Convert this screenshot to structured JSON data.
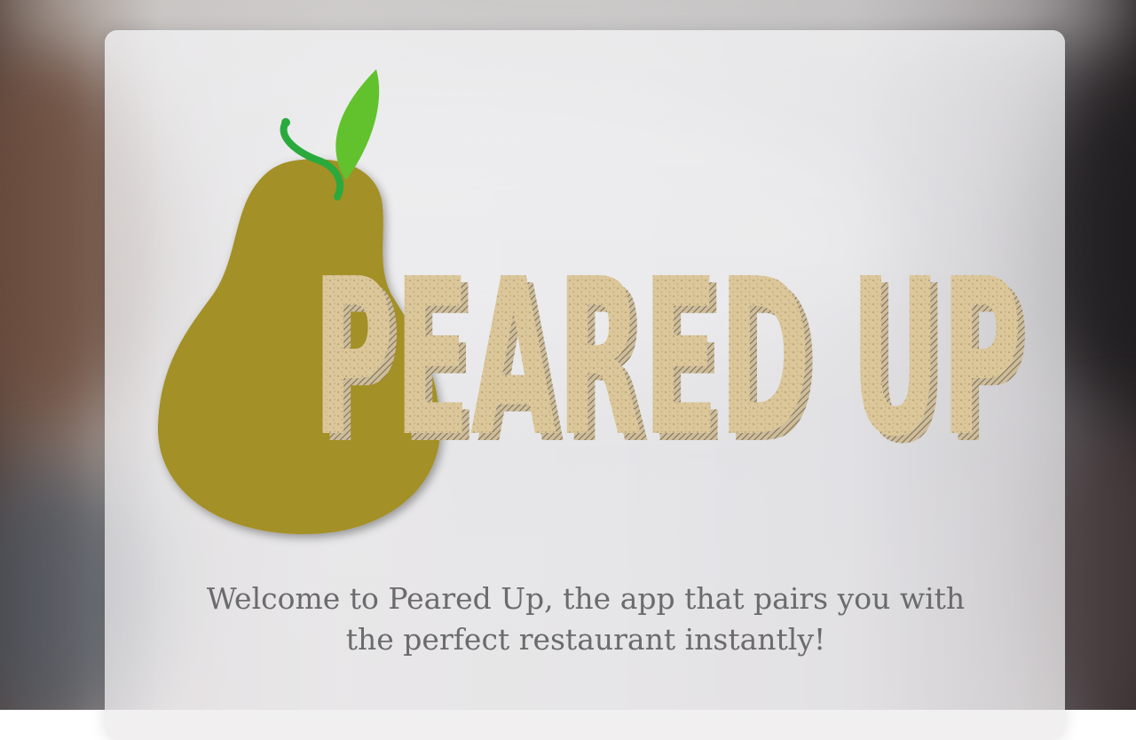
{
  "app": {
    "name": "Peared Up",
    "welcome_message": "Welcome to Peared Up, the app that pairs you with the perfect restaurant instantly!"
  },
  "logo": {
    "wordmark": "PEARED UP",
    "icon": "pear-icon",
    "colors": {
      "pear_body": "#a39028",
      "leaf": "#62c22e",
      "stem": "#2aaa3c",
      "wordmark_fill": "#dcc79a",
      "wordmark_shadow": "#8a7a5c"
    }
  },
  "colors": {
    "welcome_text": "#6b6b6e",
    "card_background": "#ececee"
  }
}
